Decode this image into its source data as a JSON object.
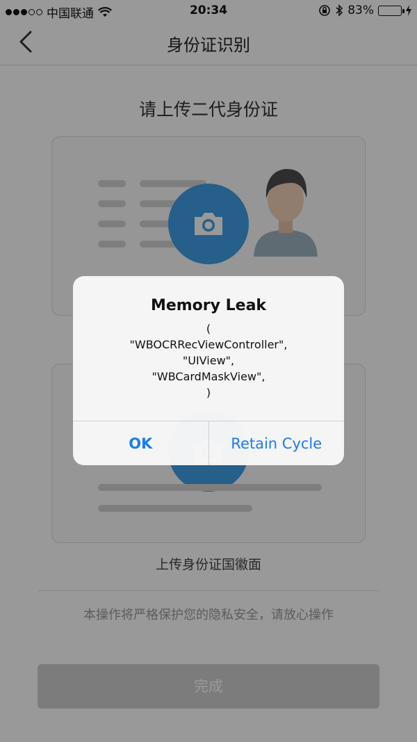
{
  "status_bar": {
    "carrier": "中国联通",
    "time": "20:34",
    "battery_percent": "83%",
    "battery_level": 0.83,
    "icons": [
      "signal-dots-icon",
      "wifi-icon",
      "orientation-lock-icon",
      "bluetooth-icon",
      "battery-icon",
      "charging-icon"
    ]
  },
  "nav": {
    "title": "身份证识别",
    "back_icon": "chevron-left-icon"
  },
  "page": {
    "title": "请上传二代身份证",
    "back_side_caption": "上传身份证国徽面",
    "privacy_note": "本操作将严格保护您的隐私安全，请放心操作",
    "done_label": "完成"
  },
  "alert": {
    "title": "Memory Leak",
    "message_lines": [
      "(",
      "\"WBOCRRecViewController\",",
      "\"UIView\",",
      "\"WBCardMaskView\",",
      ")"
    ],
    "ok_label": "OK",
    "retain_label": "Retain Cycle"
  },
  "colors": {
    "accent": "#1a7cf0",
    "camera_button": "#3f9ee6",
    "battery_fill": "#27c33c",
    "done_button_bg": "#cfcfcf"
  }
}
